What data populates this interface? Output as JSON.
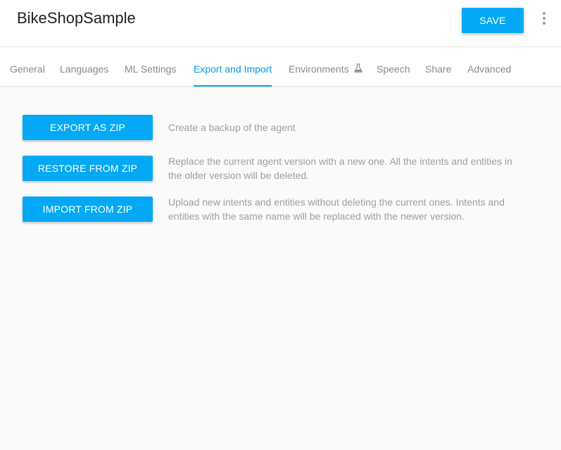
{
  "header": {
    "agent_name": "BikeShopSample",
    "save_label": "SAVE",
    "more_icon": "more-vert-icon"
  },
  "tabs": [
    {
      "label": "General",
      "active": false
    },
    {
      "label": "Languages",
      "active": false
    },
    {
      "label": "ML Settings",
      "active": false
    },
    {
      "label": "Export and Import",
      "active": true
    },
    {
      "label": "Environments",
      "active": false,
      "icon": "flask-icon"
    },
    {
      "label": "Speech",
      "active": false
    },
    {
      "label": "Share",
      "active": false
    },
    {
      "label": "Advanced",
      "active": false
    }
  ],
  "actions": [
    {
      "button_label": "EXPORT AS ZIP",
      "description": "Create a backup of the agent"
    },
    {
      "button_label": "RESTORE FROM ZIP",
      "description": "Replace the current agent version with a new one. All the intents and entities in the older version will be deleted."
    },
    {
      "button_label": "IMPORT FROM ZIP",
      "description": "Upload new intents and entities without deleting the current ones. Intents and entities with the same name will be replaced with the newer version."
    }
  ],
  "colors": {
    "accent": "#03a9f4",
    "active_tab": "#039be5",
    "inactive_text": "#8a8a8a",
    "description_text": "#9e9e9e"
  }
}
